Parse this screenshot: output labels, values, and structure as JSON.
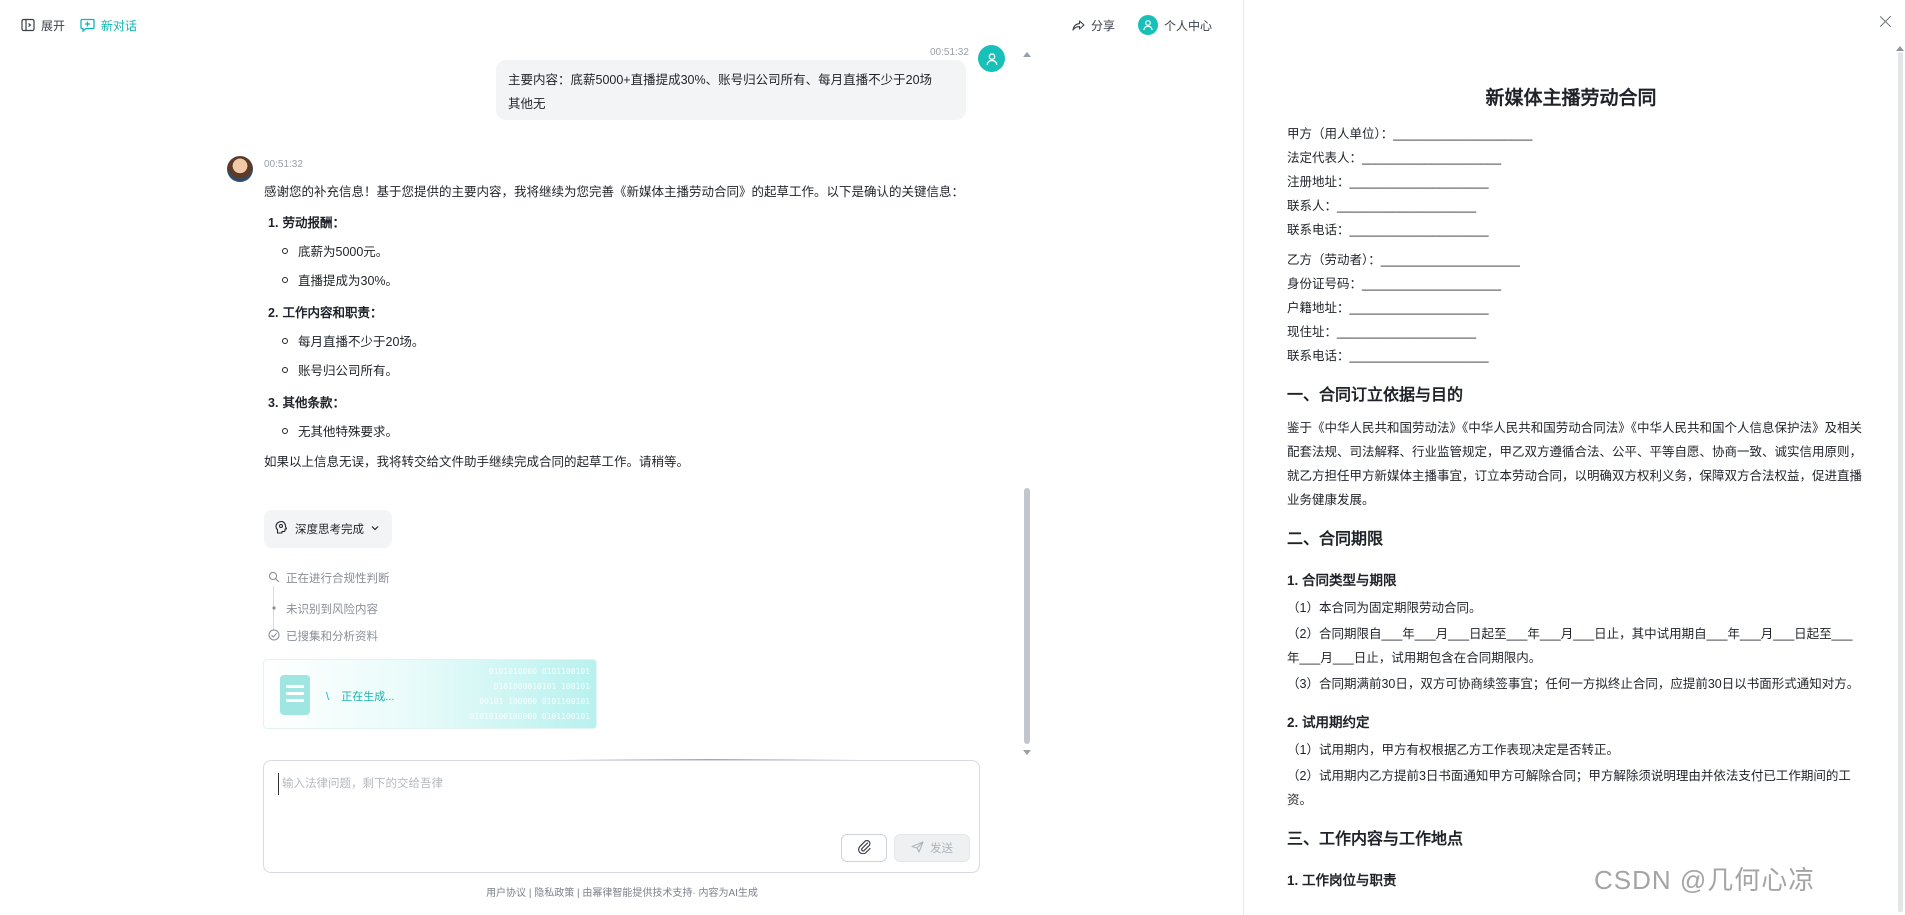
{
  "topbar": {
    "expand_label": "展开",
    "new_chat_label": "新对话",
    "share_label": "分享",
    "profile_label": "个人中心"
  },
  "user_message": {
    "time": "00:51:32",
    "text_line1": "主要内容：底薪5000+直播提成30%、账号归公司所有、每月直播不少于20场",
    "text_line2": "其他无"
  },
  "bot_message": {
    "time": "00:51:32",
    "intro": "感谢您的补充信息！基于您提供的主要内容，我将继续为您完善《新媒体主播劳动合同》的起草工作。以下是确认的关键信息：",
    "sections": [
      {
        "num": "1.",
        "title": "劳动报酬：",
        "items": [
          "底薪为5000元。",
          "直播提成为30%。"
        ]
      },
      {
        "num": "2.",
        "title": "工作内容和职责：",
        "items": [
          "每月直播不少于20场。",
          "账号归公司所有。"
        ]
      },
      {
        "num": "3.",
        "title": "其他条款：",
        "items": [
          "无其他特殊要求。"
        ]
      }
    ],
    "outro": "如果以上信息无误，我将转交给文件助手继续完成合同的起草工作。请稍等。"
  },
  "thinking": {
    "chip_label": "深度思考完成",
    "steps": [
      "正在进行合规性判断",
      "未识别到风险内容",
      "已搜集和分析资料"
    ]
  },
  "generating": {
    "status": "正在生成...",
    "binary": [
      "0101010000 0101100101",
      "0101000010101 100101",
      "00101 100000 0101100101",
      "01010100100000 0101100101"
    ]
  },
  "composer": {
    "placeholder": "输入法律问题，剩下的交给吾律",
    "send_label": "发送"
  },
  "footer": {
    "text": "用户协议 | 隐私政策 | 由幂律智能提供技术支持· 内容为AI生成"
  },
  "document": {
    "title": "新媒体主播劳动合同",
    "party_a": [
      "甲方（用人单位）：____________________",
      "法定代表人：____________________",
      "注册地址：____________________",
      "联系人：____________________",
      "联系电话：____________________"
    ],
    "party_b": [
      "乙方（劳动者）：____________________",
      "身份证号码：____________________",
      "户籍地址：____________________",
      "现住址：____________________",
      "联系电话：____________________"
    ],
    "section1_title": "一、合同订立依据与目的",
    "section1_text": "鉴于《中华人民共和国劳动法》《中华人民共和国劳动合同法》《中华人民共和国个人信息保护法》及相关配套法规、司法解释、行业监管规定，甲乙双方遵循合法、公平、平等自愿、协商一致、诚实信用原则，就乙方担任甲方新媒体主播事宜，订立本劳动合同，以明确双方权利义务，保障双方合法权益，促进直播业务健康发展。",
    "section2_title": "二、合同期限",
    "sub21_title": "1. 合同类型与期限",
    "sub21_items": [
      "（1）本合同为固定期限劳动合同。",
      "（2）合同期限自___年___月___日起至___年___月___日止，其中试用期自___年___月___日起至___年___月___日止，试用期包含在合同期限内。",
      "（3）合同期满前30日，双方可协商续签事宜；任何一方拟终止合同，应提前30日以书面形式通知对方。"
    ],
    "sub22_title": "2. 试用期约定",
    "sub22_items": [
      "（1）试用期内，甲方有权根据乙方工作表现决定是否转正。",
      "（2）试用期内乙方提前3日书面通知甲方可解除合同；甲方解除须说明理由并依法支付已工作期间的工资。"
    ],
    "section3_title": "三、工作内容与工作地点",
    "sub31_title": "1. 工作岗位与职责"
  },
  "watermark": "CSDN @几何心凉"
}
